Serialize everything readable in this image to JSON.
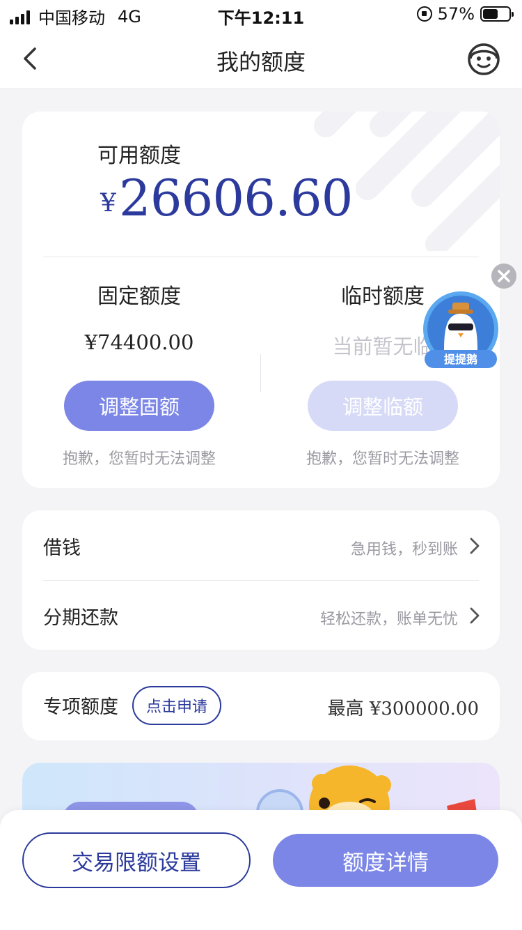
{
  "status_bar": {
    "carrier": "中国移动",
    "network": "4G",
    "time": "下午12:11",
    "battery_text": "57%",
    "battery_level": 0.57
  },
  "nav": {
    "title": "我的额度",
    "back_icon": "chevron-left-icon",
    "service_icon": "customer-service-icon"
  },
  "quota": {
    "available_label": "可用额度",
    "currency": "¥",
    "available_amount": "26606.60",
    "fixed": {
      "title": "固定额度",
      "value": "¥74400.00",
      "button": "调整固额",
      "note": "抱歉，您暂时无法调整"
    },
    "temporary": {
      "title": "临时额度",
      "value": "当前暂无临",
      "button": "调整临额",
      "note": "抱歉，您暂时无法调整"
    }
  },
  "floating_badge": {
    "label": "提提鹅",
    "close_icon": "close-icon"
  },
  "menu": [
    {
      "label": "借钱",
      "hint": "急用钱，秒到账"
    },
    {
      "label": "分期还款",
      "hint": "轻松还款，账单无忧"
    }
  ],
  "special": {
    "label": "专项额度",
    "apply_button": "点击申请",
    "max_prefix": "最高",
    "max_amount": "¥300000.00"
  },
  "bottom": {
    "limit_settings": "交易限额设置",
    "quota_details": "额度详情"
  },
  "colors": {
    "brand": "#2b3a9c",
    "button_primary": "#7b86e6",
    "button_disabled": "#d6daf7",
    "background": "#f4f4f7"
  }
}
